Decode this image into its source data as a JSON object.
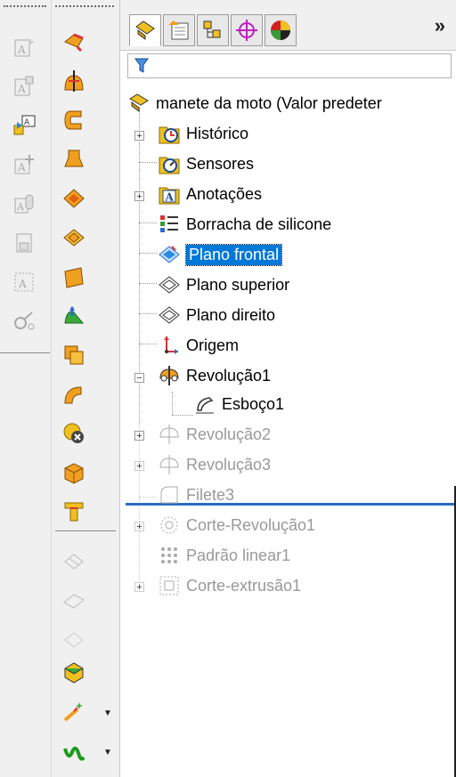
{
  "colors": {
    "selection": "#0078d7",
    "rollback_bar": "#2b6cbf",
    "dim_text": "#999999",
    "toolbar_bg": "#f0f0f0"
  },
  "tabs": {
    "more_label": "»",
    "icons": [
      "feature-manager-icon",
      "property-manager-icon",
      "configuration-manager-icon",
      "dimxpert-icon",
      "display-manager-icon"
    ]
  },
  "filter": {
    "icon": "filter-icon"
  },
  "tree": {
    "root": {
      "label": "manete da moto  (Valor predeter"
    },
    "items": [
      {
        "label": "Histórico"
      },
      {
        "label": "Sensores"
      },
      {
        "label": "Anotações"
      },
      {
        "label": "Borracha de silicone"
      },
      {
        "label": "Plano frontal"
      },
      {
        "label": "Plano superior"
      },
      {
        "label": "Plano direito"
      },
      {
        "label": "Origem"
      },
      {
        "label": "Revolução1"
      },
      {
        "label": "Esboço1"
      },
      {
        "label": "Revolução2"
      },
      {
        "label": "Revolução3"
      },
      {
        "label": "Filete3"
      },
      {
        "label": "Corte-Revolução1"
      },
      {
        "label": "Padrão linear1"
      },
      {
        "label": "Corte-extrusão1"
      }
    ]
  }
}
